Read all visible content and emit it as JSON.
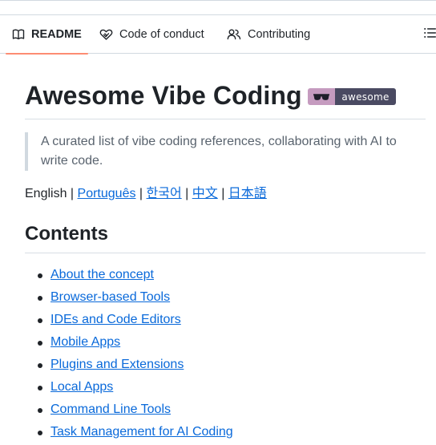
{
  "tabs": {
    "readme": "README",
    "code_of_conduct": "Code of conduct",
    "contributing": "Contributing"
  },
  "readme": {
    "title": "Awesome Vibe Coding",
    "badge_text": "awesome",
    "description": "A curated list of vibe coding references, collaborating with AI to write code.",
    "languages": {
      "current": "English",
      "links": [
        "Português",
        "한국어",
        "中文",
        "日本語"
      ],
      "separator": " | "
    },
    "contents_heading": "Contents",
    "toc": [
      "About the concept",
      "Browser-based Tools",
      "IDEs and Code Editors",
      "Mobile Apps",
      "Plugins and Extensions",
      "Local Apps",
      "Command Line Tools",
      "Task Management for AI Coding"
    ]
  },
  "colors": {
    "link": "#0969da",
    "active_tab_underline": "#fd8c73",
    "badge_left": "#c59bbf",
    "badge_right": "#4a4a62"
  },
  "icons": {
    "readme": "book-icon",
    "code_of_conduct": "code-of-conduct-heart-icon",
    "contributing": "people-icon",
    "outline": "list-outline-icon",
    "badge": "sunglasses-icon"
  }
}
